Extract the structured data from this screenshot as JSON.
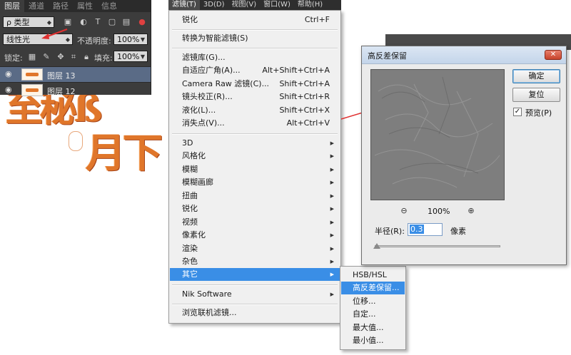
{
  "layers_panel": {
    "tabs": [
      "图层",
      "通道",
      "路径",
      "属性",
      "信息"
    ],
    "active_tab": 0,
    "filter_kind": "ρ 类型",
    "blend_mode": "线性光",
    "opacity_label": "不透明度:",
    "opacity_value": "100%",
    "lock_label": "锁定:",
    "fill_label": "填充:",
    "fill_value": "100%",
    "layers": [
      {
        "name": "图层 13",
        "selected": true,
        "visible": true
      },
      {
        "name": "图层 12",
        "selected": false,
        "visible": true
      }
    ]
  },
  "menubar": {
    "items": [
      "滤镜(T)",
      "3D(D)",
      "视图(V)",
      "窗口(W)",
      "帮助(H)"
    ],
    "active": 0
  },
  "filter_menu": {
    "top_items": [
      {
        "label": "锐化",
        "shortcut": "Ctrl+F"
      }
    ],
    "smart_items": [
      {
        "label": "转换为智能滤镜(S)"
      }
    ],
    "special_items": [
      {
        "label": "滤镜库(G)...",
        "shortcut": ""
      },
      {
        "label": "自适应广角(A)...",
        "shortcut": "Alt+Shift+Ctrl+A"
      },
      {
        "label": "Camera Raw 滤镜(C)...",
        "shortcut": "Shift+Ctrl+A"
      },
      {
        "label": "镜头校正(R)...",
        "shortcut": "Shift+Ctrl+R"
      },
      {
        "label": "液化(L)...",
        "shortcut": "Shift+Ctrl+X"
      },
      {
        "label": "消失点(V)...",
        "shortcut": "Alt+Ctrl+V"
      }
    ],
    "group_items": [
      {
        "label": "3D"
      },
      {
        "label": "风格化"
      },
      {
        "label": "模糊"
      },
      {
        "label": "模糊画廊"
      },
      {
        "label": "扭曲"
      },
      {
        "label": "锐化"
      },
      {
        "label": "视频"
      },
      {
        "label": "像素化"
      },
      {
        "label": "渲染"
      },
      {
        "label": "杂色"
      },
      {
        "label": "其它"
      }
    ],
    "highlighted_group": 10,
    "plugin_items": [
      {
        "label": "Nik Software"
      }
    ],
    "browse_items": [
      {
        "label": "浏览联机滤镜..."
      }
    ]
  },
  "submenu": {
    "items": [
      "HSB/HSL",
      "高反差保留...",
      "位移...",
      "自定...",
      "最大值...",
      "最小值..."
    ],
    "highlighted": 1
  },
  "dialog": {
    "title": "高反差保留",
    "ok_label": "确定",
    "reset_label": "复位",
    "preview_label": "预览(P)",
    "preview_checked": true,
    "zoom_out_icon": "zoom-out-icon",
    "zoom_in_icon": "zoom-in-icon",
    "zoom_level": "100%",
    "radius_label": "半径(R):",
    "radius_value": "0.3",
    "radius_unit": "像素"
  },
  "colors": {
    "menu_highlight": "#3a8ee6",
    "panel_bg": "#3c3c3c",
    "layer_selected": "#5a6b86",
    "art_orange": "#e0762a",
    "annotation_red": "#e03030"
  }
}
